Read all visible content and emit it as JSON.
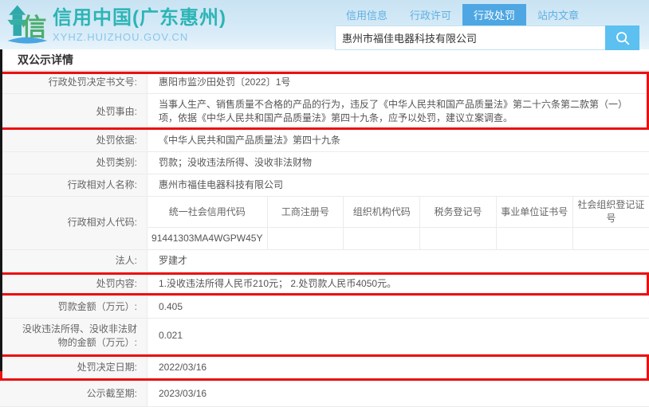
{
  "header": {
    "site_title": "信用中国(广东惠州)",
    "site_url": "XYHZ.HUIZHOU.GOV.CN",
    "tabs": [
      {
        "label": "信用信息"
      },
      {
        "label": "行政许可"
      },
      {
        "label": "行政处罚"
      },
      {
        "label": "站内文章"
      }
    ],
    "active_tab": "行政处罚",
    "search_value": "惠州市福佳电器科技有限公司"
  },
  "page": {
    "section_title": "双公示详情"
  },
  "detail": {
    "rows": [
      {
        "label": "行政处罚决定书文号:",
        "value": "惠阳市监沙田处罚〔2022〕1号"
      },
      {
        "label": "处罚事由:",
        "value": "当事人生产、销售质量不合格的产品的行为，违反了《中华人民共和国产品质量法》第二十六条第二款第（一）项，依据《中华人民共和国产品质量法》第四十九条，应予以处罚，建议立案调查。"
      },
      {
        "label": "处罚依据:",
        "value": "《中华人民共和国产品质量法》第四十九条"
      },
      {
        "label": "处罚类别:",
        "value": "罚款；没收违法所得、没收非法财物"
      },
      {
        "label": "行政相对人名称:",
        "value": "惠州市福佳电器科技有限公司"
      },
      {
        "label": "行政相对人代码:",
        "value": ""
      },
      {
        "label": "法人:",
        "value": "罗建才"
      },
      {
        "label": "处罚内容:",
        "value": "1.没收违法所得人民币210元；  2.处罚款人民币4050元。"
      },
      {
        "label": "罚款金额（万元）:",
        "value": "0.405"
      },
      {
        "label": "没收违法所得、没收非法财物的金额（万元）:",
        "value": "0.021"
      },
      {
        "label": "处罚决定日期:",
        "value": "2022/03/16"
      },
      {
        "label": "公示截至期:",
        "value": "2023/03/16"
      }
    ],
    "code_table": {
      "headers": [
        "统一社会信用代码",
        "工商注册号",
        "组织机构代码",
        "税务登记号",
        "事业单位证书号",
        "社会组织登记证号"
      ],
      "values": [
        "91441303MA4WGPW45Y",
        "",
        "",
        "",
        "",
        ""
      ]
    }
  },
  "icons": {
    "logo": "pagoda-credit-logo",
    "search": "magnifier"
  },
  "colors": {
    "brand_teal": "#2cb5b5",
    "brand_url_blue": "#8ac6e9",
    "tab_text_blue": "#5fb0e2",
    "tab_active_bg": "#4ea7e3",
    "search_button_bg": "#5cc0f0",
    "label_bg": "#f7f7f7",
    "table_border": "#ebebeb",
    "annotation_red": "#ec1010"
  }
}
